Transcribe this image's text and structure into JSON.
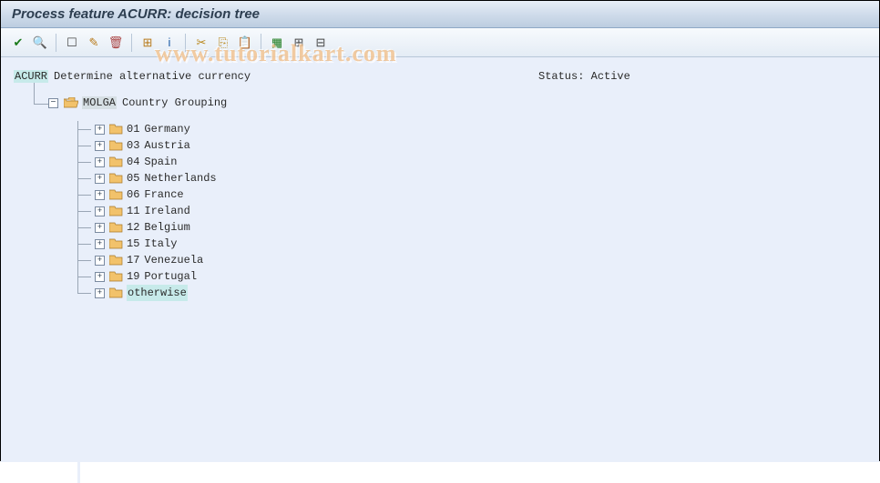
{
  "title": "Process feature ACURR: decision tree",
  "watermark": "www.tutorialkart.com",
  "status": {
    "label": "Status:",
    "value": "Active"
  },
  "toolbar_icons": [
    {
      "name": "check-icon",
      "glyph": "✔",
      "color": "#1a7a1a"
    },
    {
      "name": "search-icon",
      "glyph": "🔍",
      "color": "#1a5aa6"
    },
    {
      "name": "sep"
    },
    {
      "name": "new-icon",
      "glyph": "☐",
      "color": "#444"
    },
    {
      "name": "edit-icon",
      "glyph": "✎",
      "color": "#b87a1a"
    },
    {
      "name": "delete-icon",
      "glyph": "🗑",
      "color": "#a44"
    },
    {
      "name": "sep"
    },
    {
      "name": "tree-icon",
      "glyph": "⊞",
      "color": "#b87a1a"
    },
    {
      "name": "info-icon",
      "glyph": "i",
      "color": "#1a5aa6"
    },
    {
      "name": "sep"
    },
    {
      "name": "cut-icon",
      "glyph": "✂",
      "color": "#b8861a"
    },
    {
      "name": "copy-icon",
      "glyph": "⎘",
      "color": "#b8861a"
    },
    {
      "name": "paste-icon",
      "glyph": "📋",
      "color": "#b8861a"
    },
    {
      "name": "sep"
    },
    {
      "name": "select-icon",
      "glyph": "▦",
      "color": "#1a7a1a"
    },
    {
      "name": "expand-icon",
      "glyph": "⊞",
      "color": "#444"
    },
    {
      "name": "collapse-icon",
      "glyph": "⊟",
      "color": "#444"
    }
  ],
  "root": {
    "code": "ACURR",
    "text": "Determine alternative currency"
  },
  "group": {
    "code": "MOLGA",
    "text": "Country Grouping"
  },
  "countries": [
    {
      "code": "01",
      "name": "Germany"
    },
    {
      "code": "03",
      "name": "Austria"
    },
    {
      "code": "04",
      "name": "Spain"
    },
    {
      "code": "05",
      "name": "Netherlands"
    },
    {
      "code": "06",
      "name": "France"
    },
    {
      "code": "11",
      "name": "Ireland"
    },
    {
      "code": "12",
      "name": "Belgium"
    },
    {
      "code": "15",
      "name": "Italy"
    },
    {
      "code": "17",
      "name": "Venezuela"
    },
    {
      "code": "19",
      "name": "Portugal"
    }
  ],
  "otherwise": "otherwise"
}
